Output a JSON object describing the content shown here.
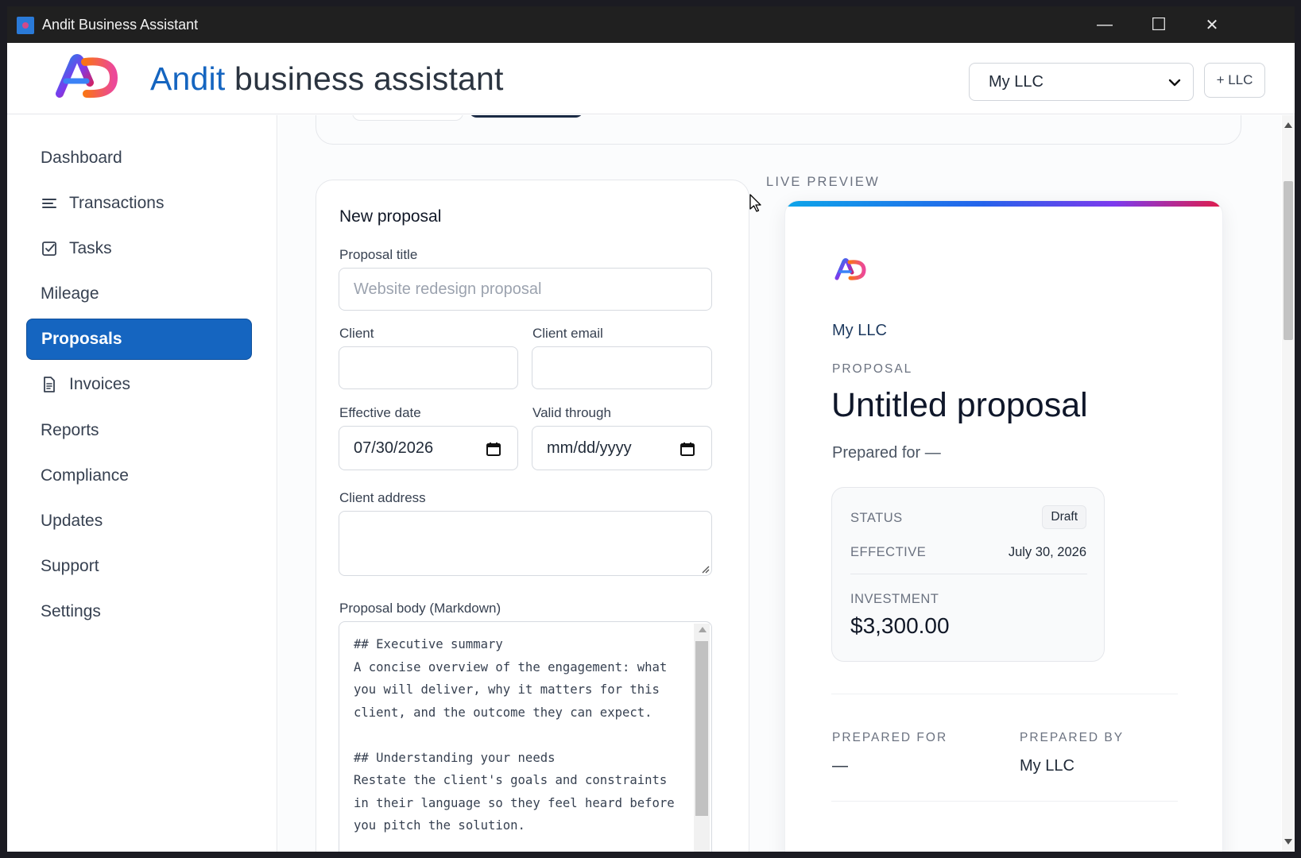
{
  "window": {
    "title": "Andit Business Assistant",
    "minimize": "—",
    "maximize": "☐",
    "close": "✕"
  },
  "header": {
    "brand_accent": "Andit",
    "brand_rest": " business assistant",
    "llc_selected": "My LLC",
    "add_llc_label": "+ LLC"
  },
  "sidebar": {
    "items": [
      {
        "label": "Dashboard",
        "icon": ""
      },
      {
        "label": "Transactions",
        "icon": "list-icon"
      },
      {
        "label": "Tasks",
        "icon": "checkbox-icon"
      },
      {
        "label": "Mileage",
        "icon": ""
      },
      {
        "label": "Proposals",
        "icon": "",
        "active": true
      },
      {
        "label": "Invoices",
        "icon": "document-icon"
      },
      {
        "label": "Reports",
        "icon": ""
      },
      {
        "label": "Compliance",
        "icon": ""
      },
      {
        "label": "Updates",
        "icon": ""
      },
      {
        "label": "Support",
        "icon": ""
      },
      {
        "label": "Settings",
        "icon": ""
      }
    ]
  },
  "form": {
    "title": "New proposal",
    "proposal_title_label": "Proposal title",
    "proposal_title_placeholder": "Website redesign proposal",
    "client_label": "Client",
    "client_value": "",
    "client_email_label": "Client email",
    "client_email_value": "",
    "effective_date_label": "Effective date",
    "effective_date_value": "07/30/2026",
    "valid_through_label": "Valid through",
    "valid_through_placeholder": "mm/dd/yyyy",
    "client_address_label": "Client address",
    "client_address_value": "",
    "body_label": "Proposal body (Markdown)",
    "body_value": "## Executive summary\nA concise overview of the engagement: what you will deliver, why it matters for this client, and the outcome they can expect.\n\n## Understanding your needs\nRestate the client's goals and constraints in their language so they feel heard before you pitch the solution."
  },
  "preview": {
    "section_label": "LIVE PREVIEW",
    "company": "My LLC",
    "eyebrow": "PROPOSAL",
    "title": "Untitled proposal",
    "prepared_for_line": "Prepared for —",
    "status_key": "STATUS",
    "status_value": "Draft",
    "effective_key": "EFFECTIVE",
    "effective_value": "July 30, 2026",
    "investment_key": "INVESTMENT",
    "investment_value": "$3,300.00",
    "prepared_for_key": "PREPARED FOR",
    "prepared_for_value": "—",
    "prepared_by_key": "PREPARED BY",
    "prepared_by_value": "My LLC"
  },
  "colors": {
    "primary": "#1565c0",
    "titlebar": "#202020",
    "gradient": [
      "#0ea5e9",
      "#2563eb",
      "#7c3aed",
      "#e11d48"
    ]
  }
}
